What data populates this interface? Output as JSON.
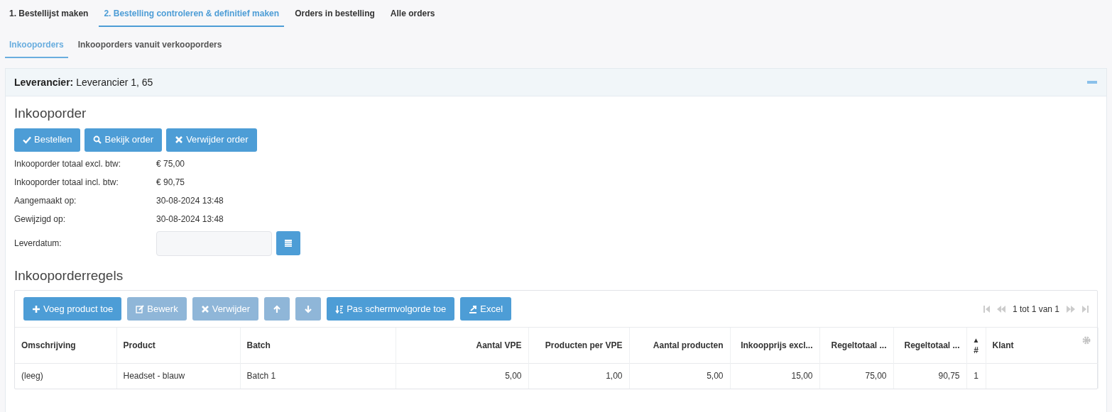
{
  "main_tabs": [
    {
      "label": "1. Bestellijst maken",
      "selected": false
    },
    {
      "label": "2. Bestelling controleren & definitief maken",
      "selected": true
    },
    {
      "label": "Orders in bestelling",
      "selected": false
    },
    {
      "label": "Alle orders",
      "selected": false
    }
  ],
  "sub_tabs": [
    {
      "label": "Inkooporders",
      "selected": true
    },
    {
      "label": "Inkooporders vanuit verkooporders",
      "selected": false
    }
  ],
  "panel": {
    "label": "Leverancier:",
    "value": "Leverancier 1, 65",
    "expanded": true
  },
  "order": {
    "title": "Inkooporder",
    "buttons": [
      {
        "label": "Bestellen",
        "kind": "check",
        "disabled": false
      },
      {
        "label": "Bekijk order",
        "kind": "search",
        "disabled": false
      },
      {
        "label": "Verwijder order",
        "kind": "x",
        "disabled": false
      }
    ],
    "fields": [
      {
        "label": "Inkooporder totaal excl. btw:",
        "value": "€ 75,00"
      },
      {
        "label": "Inkooporder totaal incl. btw:",
        "value": "€ 90,75"
      },
      {
        "label": "Aangemaakt op:",
        "value": "30-08-2024 13:48"
      },
      {
        "label": "Gewijzigd op:",
        "value": "30-08-2024 13:48"
      }
    ],
    "delivery_date": {
      "label": "Leverdatum:"
    }
  },
  "lines": {
    "title": "Inkooporderregels",
    "toolbar": [
      {
        "label": "Voeg product toe",
        "kind": "plus",
        "disabled": false
      },
      {
        "label": "Bewerk",
        "kind": "edit",
        "disabled": true
      },
      {
        "label": "Verwijder",
        "kind": "x",
        "disabled": true
      },
      {
        "kind": "up",
        "disabled": true
      },
      {
        "kind": "down",
        "disabled": true
      },
      {
        "label": "Pas schermvolgorde toe",
        "kind": "sort",
        "disabled": false
      },
      {
        "label": "Excel",
        "kind": "export",
        "disabled": false
      }
    ],
    "paging": "1 tot 1 van 1",
    "columns": [
      {
        "label": "Omschrijving"
      },
      {
        "label": "Product"
      },
      {
        "label": "Batch"
      },
      {
        "label": "Aantal VPE"
      },
      {
        "label": "Producten per VPE"
      },
      {
        "label": "Aantal producten"
      },
      {
        "label": "Inkoopprijs excl..."
      },
      {
        "label": "Regeltotaal ..."
      },
      {
        "label": "Regeltotaal ..."
      },
      {
        "label": "#",
        "sort_arrow": "▲"
      },
      {
        "label": "Klant"
      }
    ],
    "rows": [
      [
        "(leeg)",
        "Headset - blauw",
        "Batch 1",
        "5,00",
        "1,00",
        "5,00",
        "15,00",
        "75,00",
        "90,75",
        "1",
        ""
      ]
    ]
  }
}
